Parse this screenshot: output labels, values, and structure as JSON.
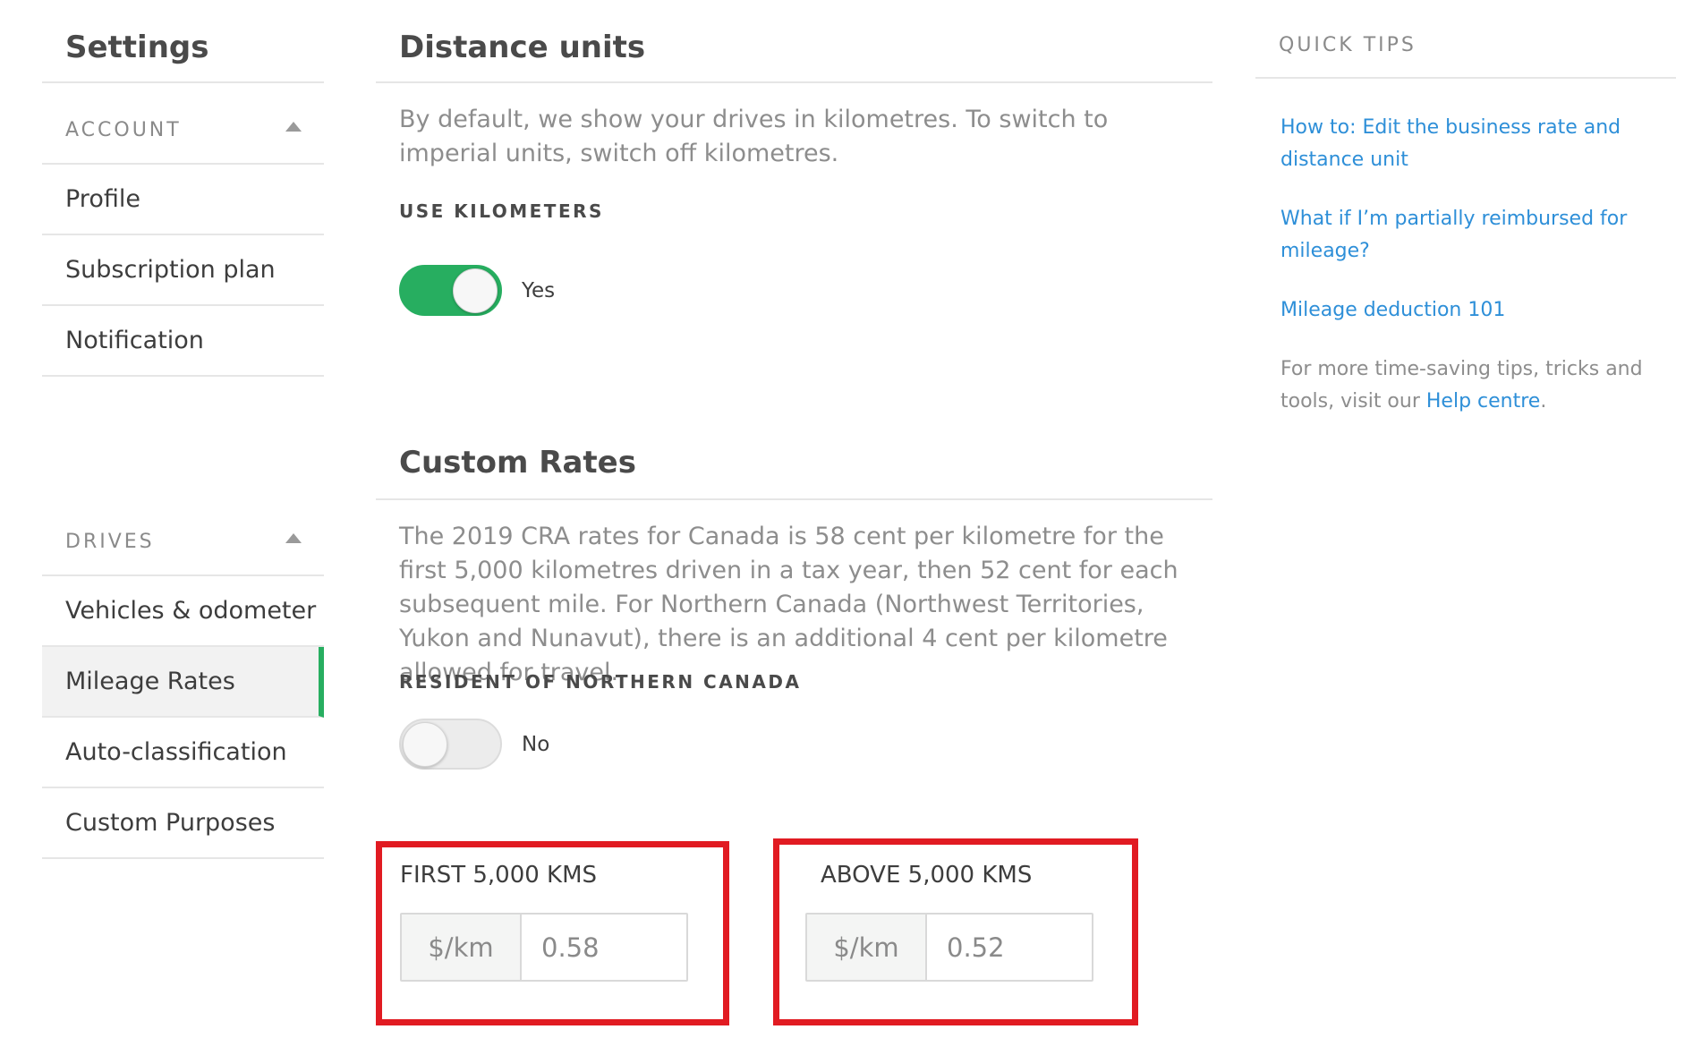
{
  "sidebar": {
    "title": "Settings",
    "account_header": "ACCOUNT",
    "account_items": [
      "Profile",
      "Subscription plan",
      "Notification"
    ],
    "drives_header": "DRIVES",
    "drives_items": [
      "Vehicles & odometer",
      "Mileage Rates",
      "Auto-classification",
      "Custom Purposes"
    ],
    "active_item": "Mileage Rates"
  },
  "distance": {
    "title": "Distance units",
    "description": "By default, we show your drives in kilometres. To switch to imperial units, switch off kilometres.",
    "toggle_label": "USE KILOMETERS",
    "toggle_state": "Yes"
  },
  "custom_rates": {
    "title": "Custom Rates",
    "description": "The 2019 CRA rates for Canada is 58 cent per kilometre for the first 5,000 kilometres driven in a tax year, then 52 cent for each subsequent mile. For Northern Canada (Northwest Territories, Yukon and Nunavut), there is an additional 4 cent per kilometre allowed for travel.",
    "toggle_label": "RESIDENT OF NORTHERN CANADA",
    "toggle_state": "No",
    "first": {
      "label": "FIRST 5,000 KMS",
      "unit": "$/km",
      "value": "0.58"
    },
    "above": {
      "label": "ABOVE 5,000 KMS",
      "unit": "$/km",
      "value": "0.52"
    }
  },
  "tips": {
    "title": "QUICK TIPS",
    "links": [
      "How to: Edit the business rate and distance unit",
      "What if I’m partially reimbursed for mileage?",
      "Mileage deduction 101"
    ],
    "note_prefix": "For more time-saving tips, tricks and tools, visit our",
    "note_link": "Help centre",
    "note_suffix": "."
  },
  "colors": {
    "accent_green": "#27ae60",
    "link_blue": "#2e8fd8",
    "highlight_red": "#e11b22"
  }
}
